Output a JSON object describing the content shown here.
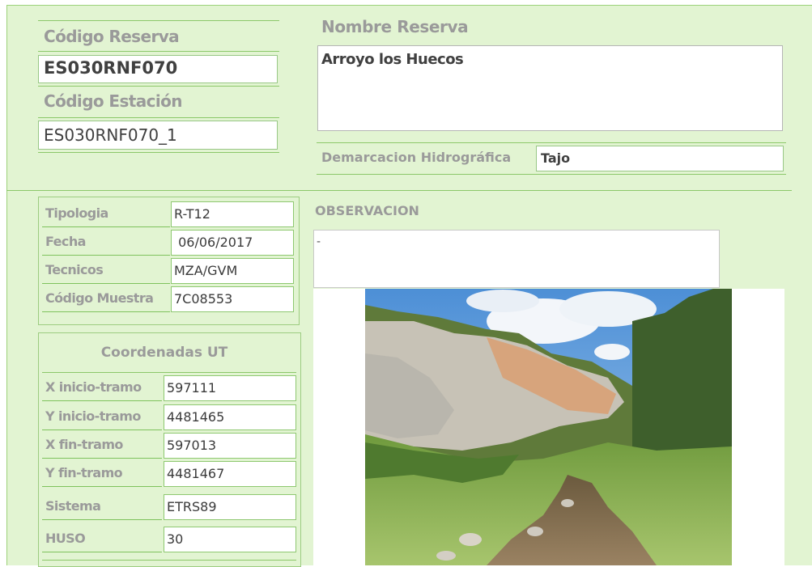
{
  "reserva": {
    "codigo_label": "Código Reserva",
    "codigo_value": "ES030RNF070",
    "estacion_label": "Código Estación",
    "estacion_value": "ES030RNF070_1",
    "nombre_label": "Nombre Reserva",
    "nombre_value": "Arroyo los Huecos",
    "demarcacion_label": "Demarcacion Hidrográfica",
    "demarcacion_value": "Tajo"
  },
  "muestra": {
    "rows": [
      {
        "label": "Tipologia",
        "value": "R-T12"
      },
      {
        "label": "Fecha",
        "value": " 06/06/2017"
      },
      {
        "label": "Tecnicos",
        "value": "MZA/GVM"
      },
      {
        "label": "Código Muestra",
        "value": "7C08553"
      }
    ]
  },
  "coordenadas": {
    "title": "Coordenadas UT",
    "rows": [
      {
        "label": "X inicio-tramo",
        "value": "597111"
      },
      {
        "label": "Y inicio-tramo",
        "value": "4481465"
      },
      {
        "label": "X fin-tramo",
        "value": "597013"
      },
      {
        "label": "Y fin-tramo",
        "value": "4481467"
      },
      {
        "label": "Sistema",
        "value": "ETRS89"
      },
      {
        "label": "HUSO",
        "value": "30"
      }
    ]
  },
  "observacion": {
    "label": "OBSERVACION",
    "value": "-"
  },
  "photo": {
    "icon": "landscape-photo"
  }
}
